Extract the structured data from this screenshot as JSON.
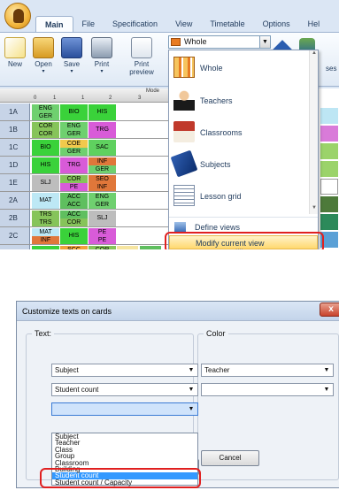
{
  "ribbon": {
    "tabs": [
      "Main",
      "File",
      "Specification",
      "View",
      "Timetable",
      "Options",
      "Hel"
    ],
    "buttons": [
      {
        "label": "New"
      },
      {
        "label": "Open"
      },
      {
        "label": "Save"
      },
      {
        "label": "Print"
      },
      {
        "label": "Print preview"
      }
    ],
    "view_select": "Whole",
    "right_partial_label": "ses"
  },
  "grid": {
    "header_label": "Mode",
    "rows": [
      {
        "name": "1A",
        "cells": [
          [
            "ENG",
            "GER"
          ],
          [
            "BIO"
          ],
          [
            "HIS"
          ]
        ]
      },
      {
        "name": "1B",
        "cells": [
          [
            "COR",
            "COR"
          ],
          [
            "ENG",
            "GER"
          ],
          [
            "TRG"
          ]
        ]
      },
      {
        "name": "1C",
        "cells": [
          [
            "BIO"
          ],
          [
            "COE",
            "GER"
          ],
          [
            "SAC"
          ]
        ]
      },
      {
        "name": "1D",
        "cells": [
          [
            "HIS"
          ],
          [
            "TRG"
          ],
          [
            "INF",
            "GER"
          ]
        ]
      },
      {
        "name": "1E",
        "cells": [
          [
            "SLJ"
          ],
          [
            "COR",
            "PE"
          ],
          [
            "SEO",
            "INF"
          ]
        ]
      },
      {
        "name": "2A",
        "cells": [
          [
            "MAT"
          ],
          [
            "ACC",
            "ACC"
          ],
          [
            "ENG",
            "GER"
          ]
        ]
      },
      {
        "name": "2B",
        "cells": [
          [
            "TRS",
            "TRS"
          ],
          [
            "ACC",
            "COR"
          ],
          [
            "SLJ"
          ]
        ]
      },
      {
        "name": "2C",
        "cells": [
          [
            "MAT",
            "INF"
          ],
          [
            "HIS"
          ],
          [
            "PE",
            "PE"
          ]
        ]
      },
      {
        "name": "2D",
        "cells": [
          [
            "HIS"
          ],
          [
            "SCC",
            "PE"
          ],
          [
            "COR",
            "COR"
          ]
        ]
      }
    ],
    "extra_cells": [
      "COE",
      "ACC",
      "ACC"
    ]
  },
  "dropdown": {
    "items": [
      {
        "label": "Whole",
        "icon": "grid-icon"
      },
      {
        "label": "Teachers",
        "icon": "teacher-icon"
      },
      {
        "label": "Classrooms",
        "icon": "house-icon"
      },
      {
        "label": "Subjects",
        "icon": "book-icon"
      },
      {
        "label": "Lesson grid",
        "icon": "lesson-grid-icon"
      }
    ],
    "define_views": "Define views",
    "modify_view": "Modify current view",
    "dots": "...."
  },
  "dialog": {
    "title": "Customize texts on cards",
    "close": "x",
    "text_label": "Text:",
    "color_label": "Color",
    "text_combo_1": "Subject",
    "text_combo_2": "Student count",
    "text_combo_3": "",
    "color_combo_1": "Teacher",
    "color_combo_2": "",
    "options": [
      "Subject",
      "Teacher",
      "Class",
      "Group",
      "Classroom",
      "Building",
      "Student count",
      "Student count / Capacity"
    ],
    "ok_label": "",
    "cancel_label": "Cancel"
  },
  "colors": {
    "highlight": "#e02020",
    "selected_option": "#3399ff"
  }
}
